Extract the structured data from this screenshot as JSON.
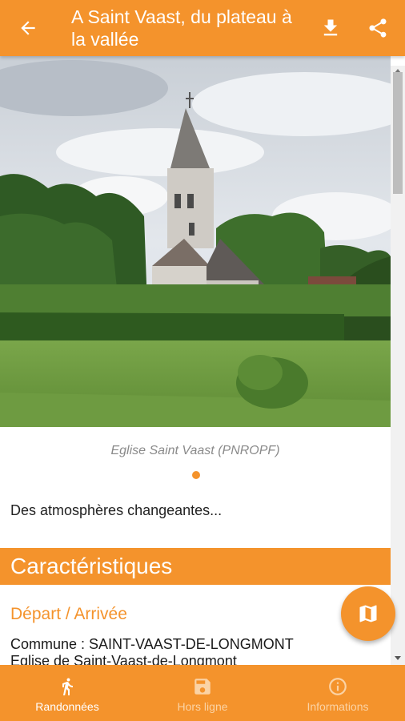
{
  "header": {
    "title": "A Saint Vaast, du plateau à la vallée",
    "back_icon": "arrow-left-icon",
    "download_icon": "download-icon",
    "share_icon": "share-icon"
  },
  "gallery": {
    "caption": "Eglise Saint Vaast (PNROPF)"
  },
  "intro_text": "Des atmosphères changeantes...",
  "characteristics": {
    "header": "Caractéristiques",
    "start_title": "Départ / Arrivée",
    "commune_line": "Commune : SAINT-VAAST-DE-LONGMONT",
    "place_line": "Eglise de Saint-Vaast-de-Longmont"
  },
  "fab": {
    "icon": "map-icon"
  },
  "bottom_nav": {
    "items": [
      {
        "label": "Randonnées",
        "icon": "hiker-icon"
      },
      {
        "label": "Hors ligne",
        "icon": "save-icon"
      },
      {
        "label": "Informations",
        "icon": "info-icon"
      }
    ]
  },
  "colors": {
    "accent": "#f4932c",
    "inactive_nav": "#fbd3a5"
  }
}
